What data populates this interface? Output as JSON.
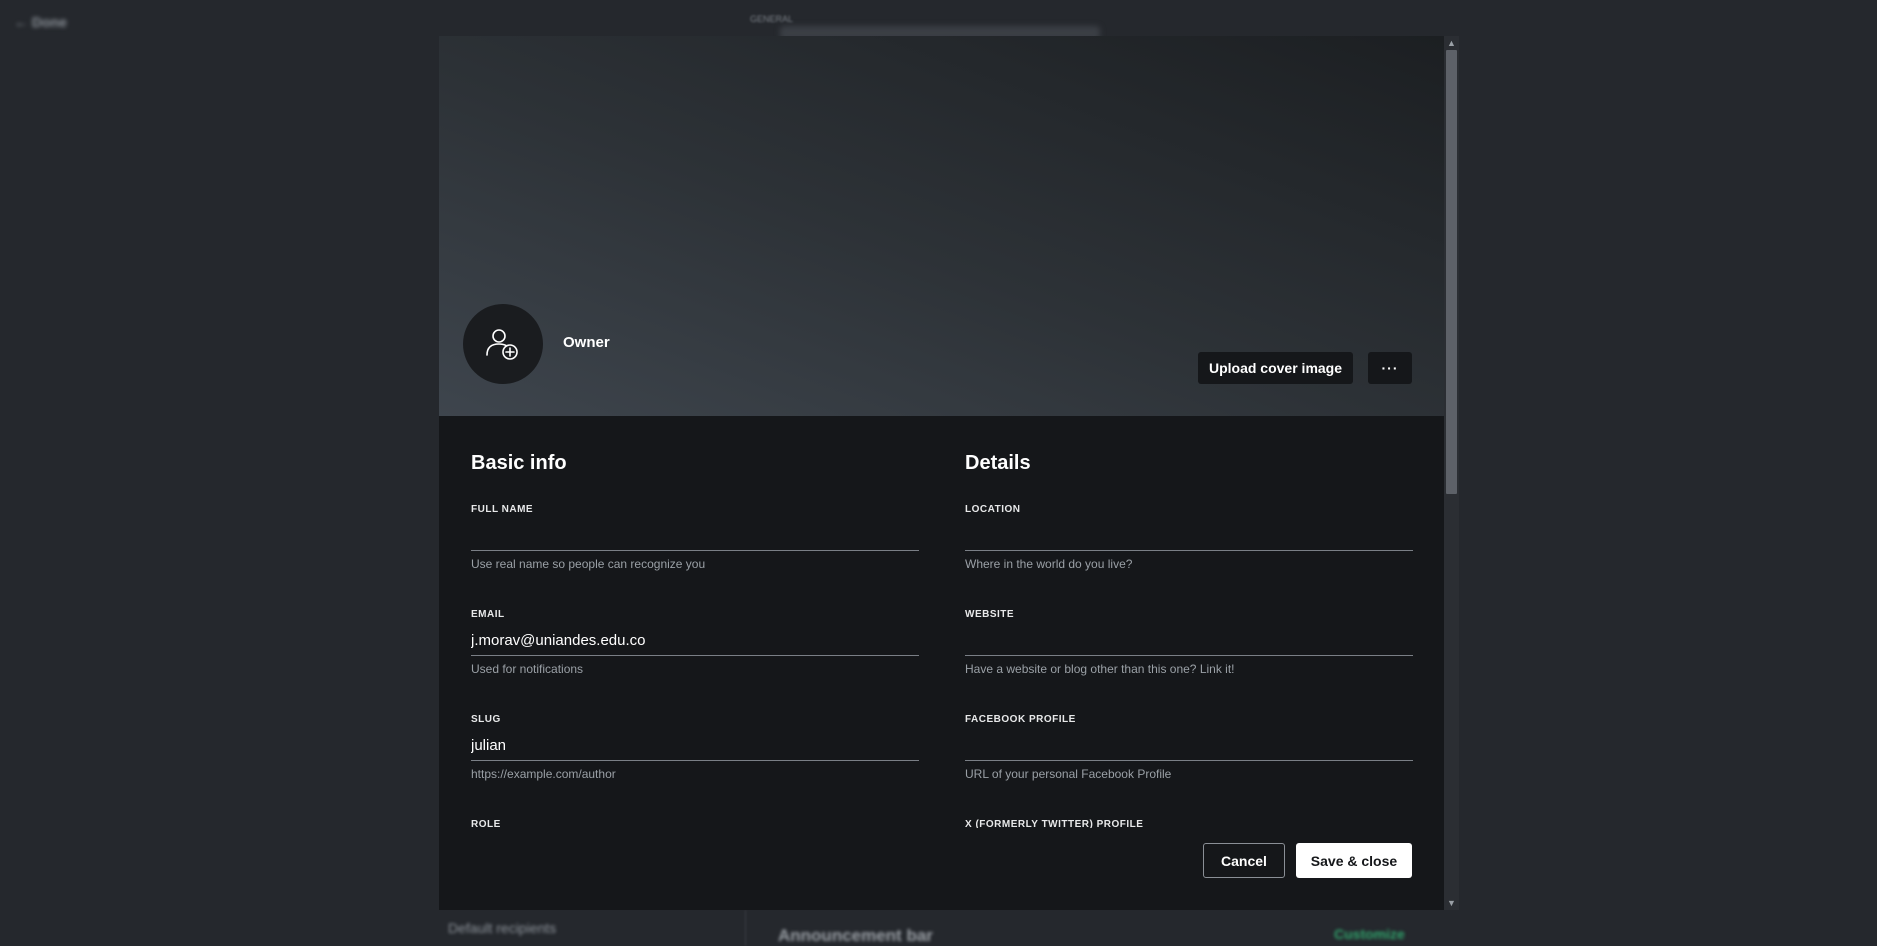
{
  "background": {
    "done_label": "← Done",
    "section_label": "GENERAL",
    "left_item": "Default recipients",
    "mid_item": "Announcement bar",
    "right_action": "Customize"
  },
  "profile": {
    "role_label": "Owner",
    "avatar_icon": "add-user-icon",
    "upload_cover_label": "Upload cover image",
    "more_label": "···"
  },
  "basic_info": {
    "title": "Basic info",
    "fields": [
      {
        "label": "FULL NAME",
        "value": "",
        "hint": "Use real name so people can recognize you"
      },
      {
        "label": "EMAIL",
        "value": "j.morav@uniandes.edu.co",
        "hint": "Used for notifications"
      },
      {
        "label": "SLUG",
        "value": "julian",
        "hint": "https://example.com/author"
      },
      {
        "label": "ROLE",
        "value": "",
        "hint": ""
      }
    ]
  },
  "details": {
    "title": "Details",
    "fields": [
      {
        "label": "LOCATION",
        "value": "",
        "hint": "Where in the world do you live?"
      },
      {
        "label": "WEBSITE",
        "value": "",
        "hint": "Have a website or blog other than this one? Link it!"
      },
      {
        "label": "FACEBOOK PROFILE",
        "value": "",
        "hint": "URL of your personal Facebook Profile"
      },
      {
        "label": "X (FORMERLY TWITTER) PROFILE",
        "value": "",
        "hint": ""
      }
    ]
  },
  "footer": {
    "cancel_label": "Cancel",
    "save_label": "Save & close"
  }
}
